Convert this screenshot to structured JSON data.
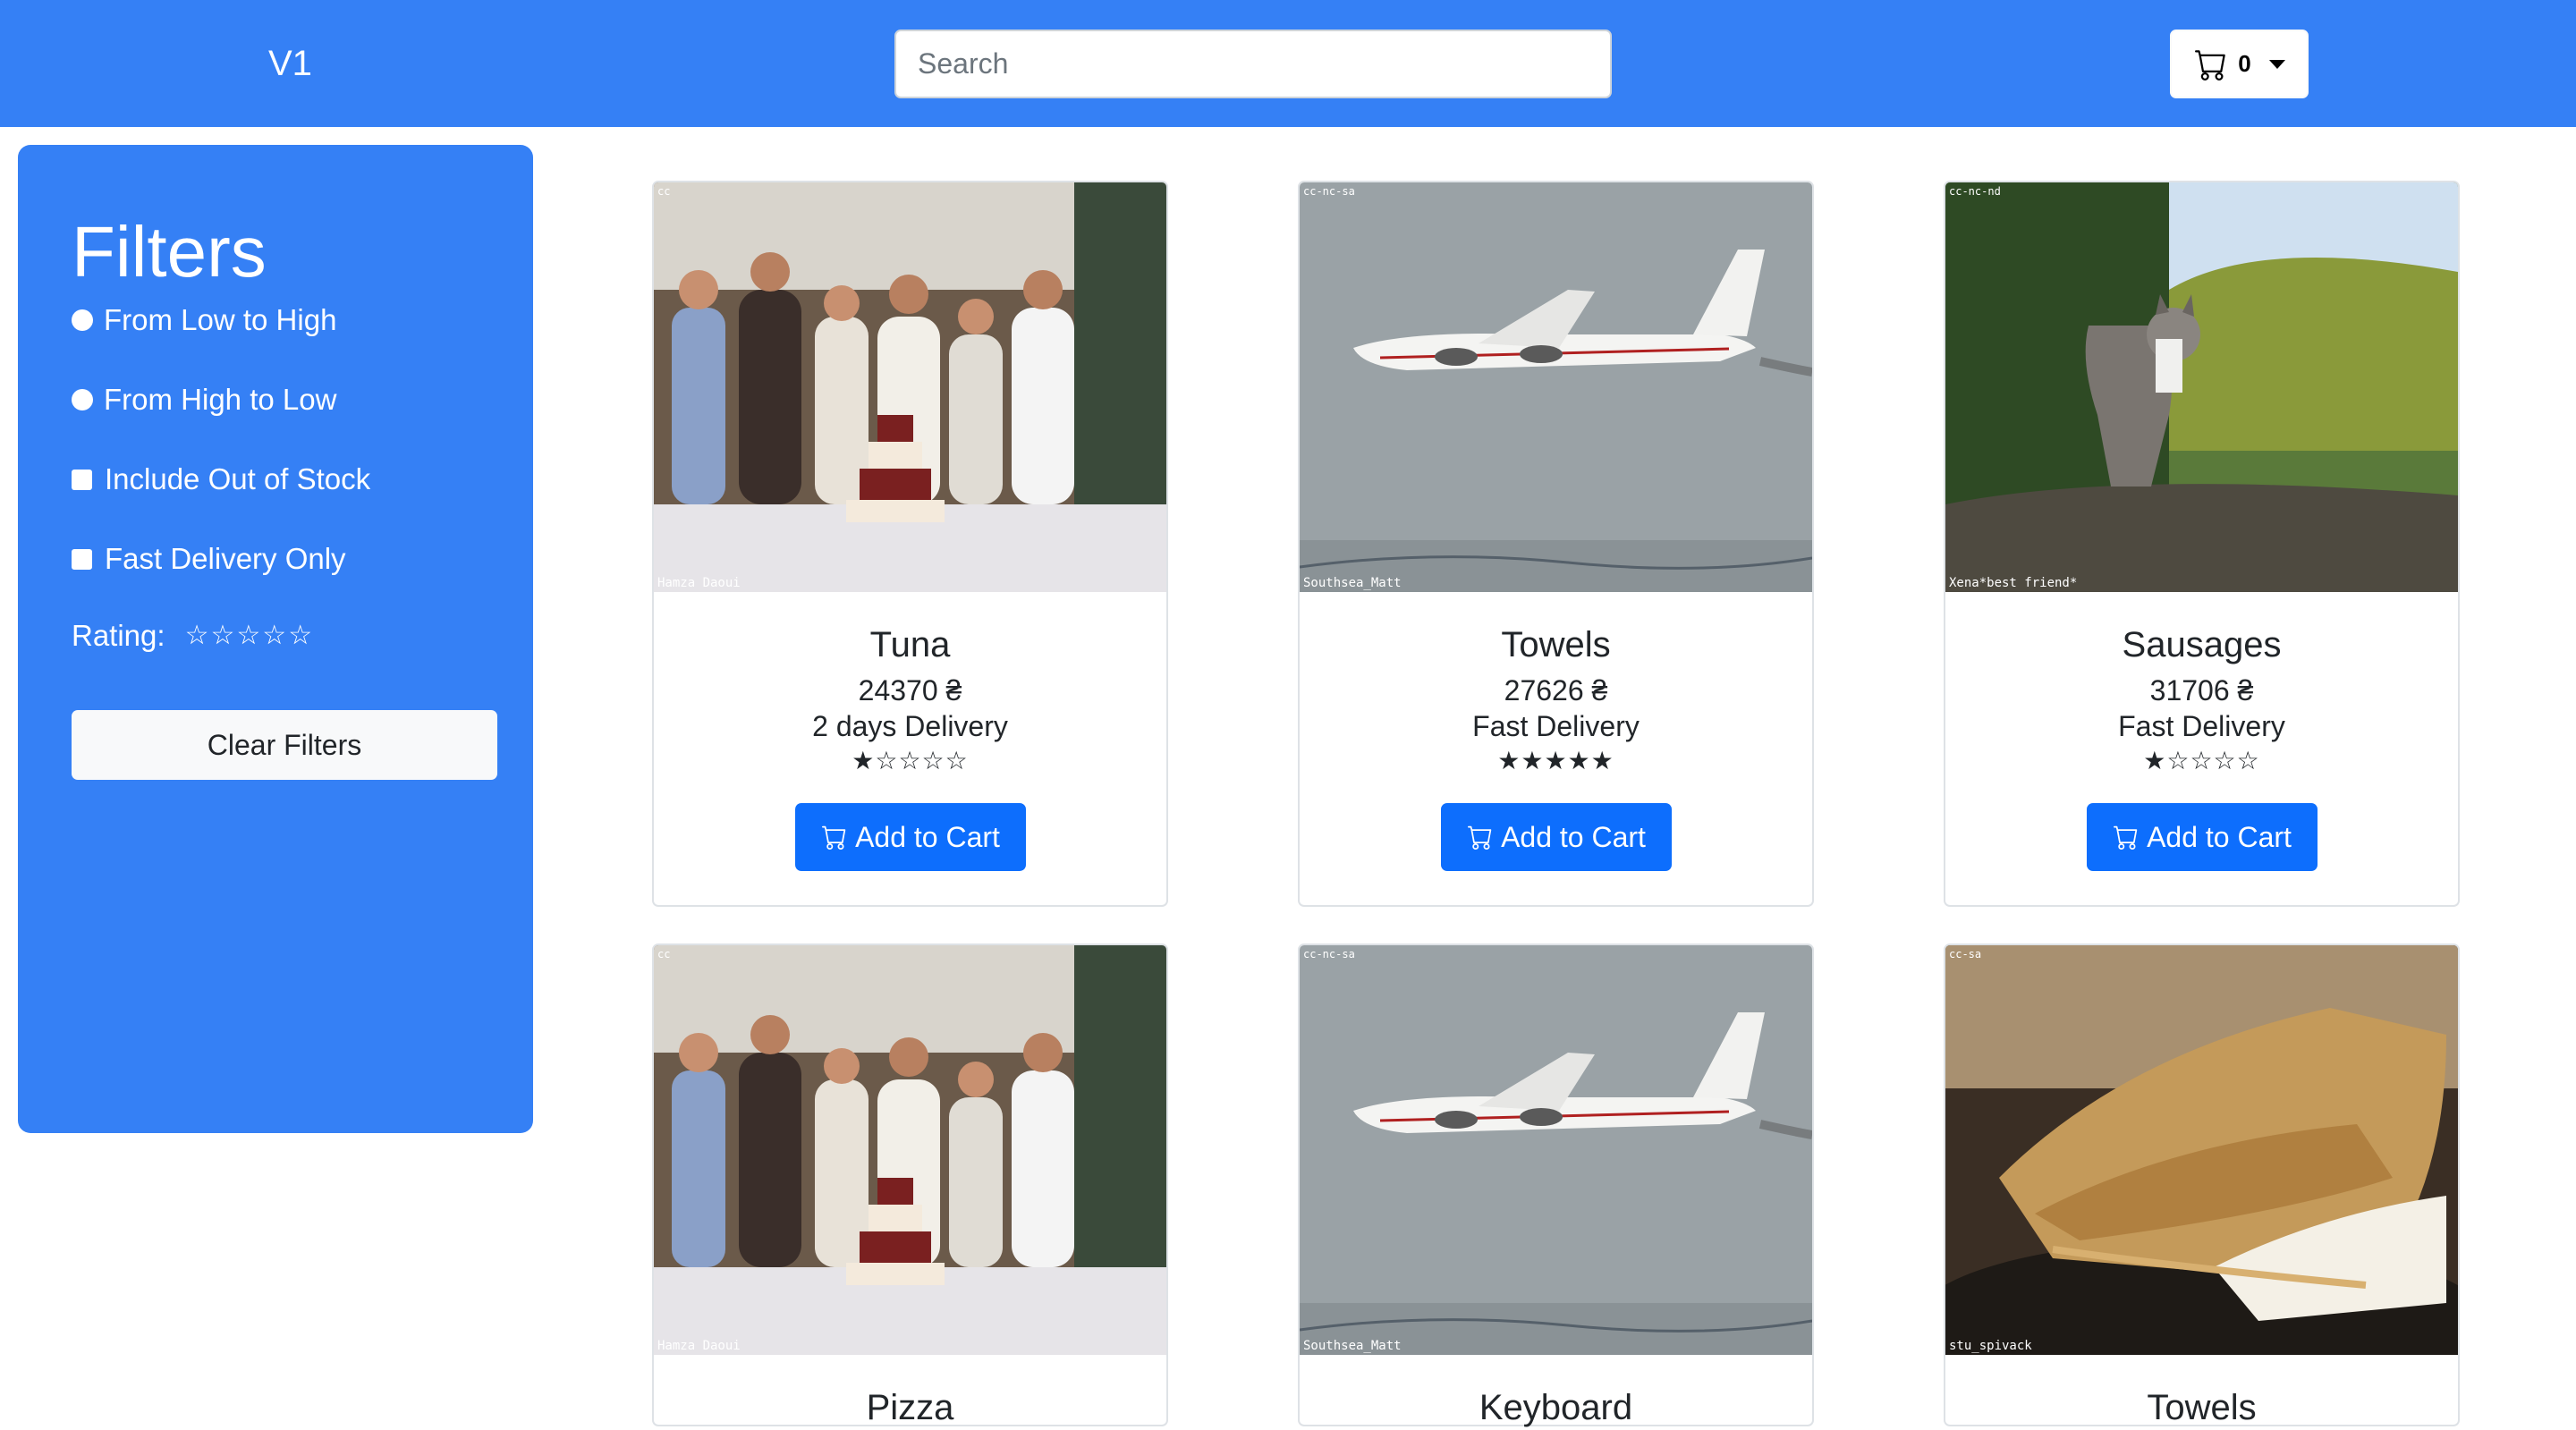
{
  "navbar": {
    "brand": "V1",
    "search_placeholder": "Search",
    "cart_count": "0"
  },
  "filters": {
    "title": "Filters",
    "options": [
      "From Low to High",
      "From High to Low",
      "Include Out of Stock",
      "Fast Delivery Only"
    ],
    "rating_label": "Rating:",
    "rating_value": 0,
    "clear_label": "Clear Filters"
  },
  "products": [
    {
      "name": "Tuna",
      "price": "24370 ₴",
      "delivery": "2 days Delivery",
      "stars": "★☆☆☆☆",
      "image": "wedding-cake-photo",
      "image_tag": "cc",
      "image_credit": "Hamza Daoui",
      "button": "Add to Cart"
    },
    {
      "name": "Towels",
      "price": "27626 ₴",
      "delivery": "Fast Delivery",
      "stars": "★★★★★",
      "image": "airplane-photo",
      "image_tag": "cc-nc-sa",
      "image_credit": "Southsea_Matt",
      "button": "Add to Cart"
    },
    {
      "name": "Sausages",
      "price": "31706 ₴",
      "delivery": "Fast Delivery",
      "stars": "★☆☆☆☆",
      "image": "cat-photo",
      "image_tag": "cc-nc-nd",
      "image_credit": "Xena*best friend*",
      "button": "Add to Cart"
    },
    {
      "name": "Pizza",
      "price": "",
      "delivery": "",
      "stars": "",
      "image": "wedding-cake-photo",
      "image_tag": "cc",
      "image_credit": "Hamza Daoui",
      "button": ""
    },
    {
      "name": "Keyboard",
      "price": "",
      "delivery": "",
      "stars": "",
      "image": "airplane-photo",
      "image_tag": "cc-nc-sa",
      "image_credit": "Southsea_Matt",
      "button": ""
    },
    {
      "name": "Towels",
      "price": "",
      "delivery": "",
      "stars": "",
      "image": "cake-slice-photo",
      "image_tag": "cc-sa",
      "image_credit": "stu_spivack",
      "button": ""
    }
  ],
  "colors": {
    "primary": "#3580f5",
    "button": "#0d6efd",
    "text": "#212529"
  }
}
